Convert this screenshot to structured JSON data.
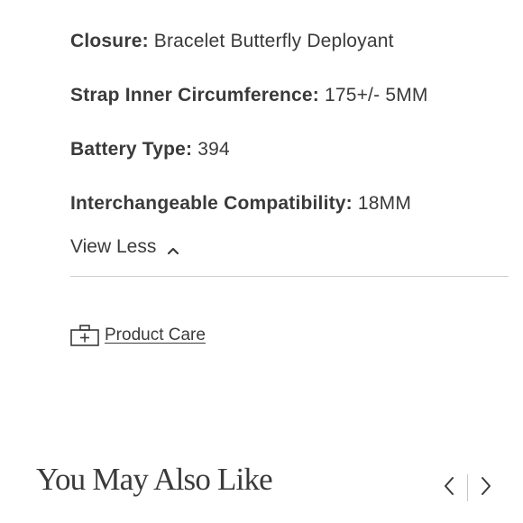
{
  "specs": [
    {
      "label": "Closure:",
      "value": "Bracelet Butterfly Deployant"
    },
    {
      "label": "Strap Inner Circumference:",
      "value": "175+/- 5MM"
    },
    {
      "label": "Battery Type:",
      "value": "394"
    },
    {
      "label": "Interchangeable Compatibility:",
      "value": "18MM"
    }
  ],
  "toggle": {
    "label": "View Less",
    "icon": "chevron-up-icon"
  },
  "product_care": {
    "label": "Product Care",
    "icon": "first-aid-kit-icon"
  },
  "recommendations": {
    "title": "You May Also Like",
    "prev_icon": "chevron-left-icon",
    "next_icon": "chevron-right-icon"
  },
  "colors": {
    "text": "#3a3a3a",
    "divider": "#cfcfcf",
    "background": "#ffffff"
  }
}
